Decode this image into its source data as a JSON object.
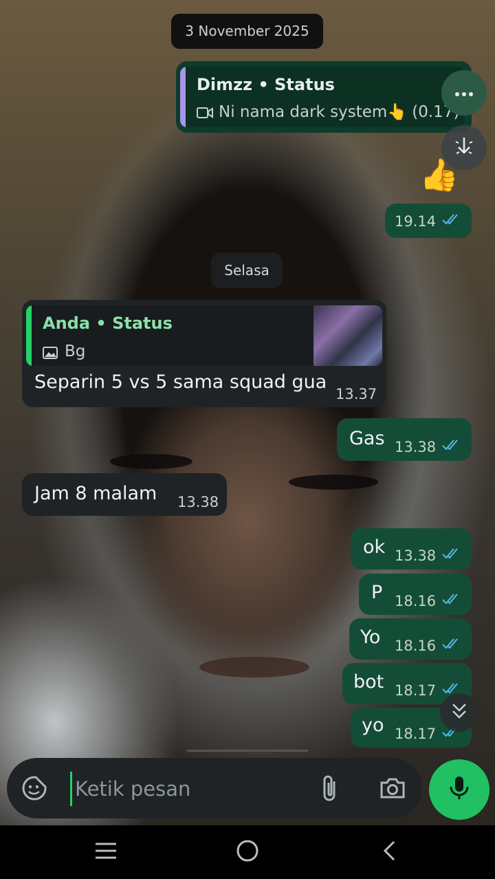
{
  "chat": {
    "date_separator": "3 November 2025",
    "day_separator": "Selasa"
  },
  "messages": {
    "status_reply_out": {
      "quote_author": "Dimzz • Status",
      "quote_text": "Ni nama dark system👆 (0.17)",
      "quote_icon": "video-icon",
      "body_emoji": "👍",
      "time": "19.14"
    },
    "status_reply_in": {
      "quote_author": "Anda • Status",
      "quote_text": "Bg",
      "quote_icon": "image-icon",
      "text": "Separin 5 vs 5 sama squad gua",
      "time": "13.37"
    },
    "m_gas": {
      "text": "Gas",
      "time": "13.38"
    },
    "m_jam": {
      "text": "Jam 8 malam",
      "time": "13.38"
    },
    "m_ok": {
      "text": "ok",
      "time": "13.38"
    },
    "m_p": {
      "text": "P",
      "time": "18.16"
    },
    "m_yo1": {
      "text": "Yo",
      "time": "18.16"
    },
    "m_bot": {
      "text": "bot",
      "time": "18.17"
    },
    "m_yo2": {
      "text": "yo",
      "time": "18.17"
    }
  },
  "composer": {
    "placeholder": "Ketik pesan",
    "emoji_icon": "sticker-icon",
    "attach_icon": "paperclip-icon",
    "camera_icon": "camera-icon",
    "mic_icon": "mic-icon"
  },
  "floating": {
    "more_icon": "more-horizontal-icon",
    "ai_icon": "sparkle-download-icon",
    "scroll_down_icon": "double-chevron-down-icon"
  },
  "navbar": {
    "menu_icon": "menu-icon",
    "home_icon": "home-circle-icon",
    "back_icon": "back-chevron-icon"
  },
  "colors": {
    "outgoing_bubble": "#144d37",
    "incoming_bubble": "#1f2326",
    "read_ticks": "#53bdeb",
    "accent_green": "#21c063",
    "quote_bar_status": "#a993e8",
    "quote_bar_self": "#25d366"
  }
}
